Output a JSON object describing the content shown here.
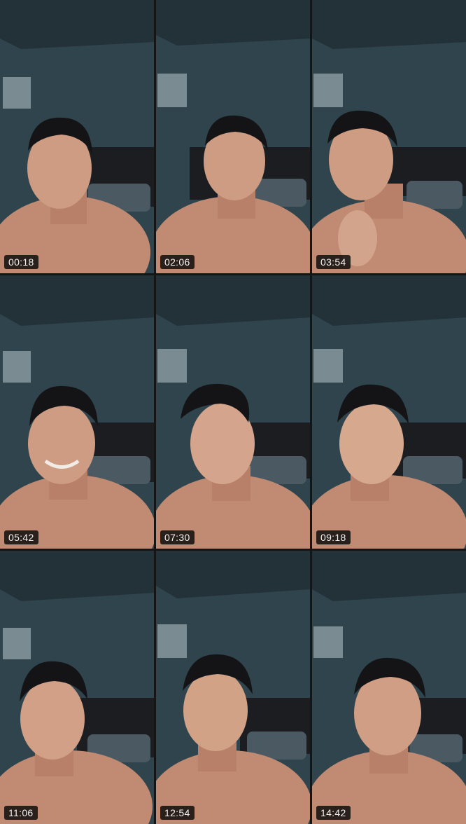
{
  "frames": [
    {
      "timestamp": "00:18"
    },
    {
      "timestamp": "02:06"
    },
    {
      "timestamp": "03:54"
    },
    {
      "timestamp": "05:42"
    },
    {
      "timestamp": "07:30"
    },
    {
      "timestamp": "09:18"
    },
    {
      "timestamp": "11:06"
    },
    {
      "timestamp": "12:54"
    },
    {
      "timestamp": "14:42"
    }
  ],
  "colors": {
    "background": "#151515",
    "wall": "#2f444c",
    "ceiling": "#223238",
    "headboard": "#1c1d20",
    "skin": "#c9977d",
    "hair": "#141416",
    "timestamp_bg": "#0b0b0b",
    "timestamp_text": "#f2f2f2"
  }
}
